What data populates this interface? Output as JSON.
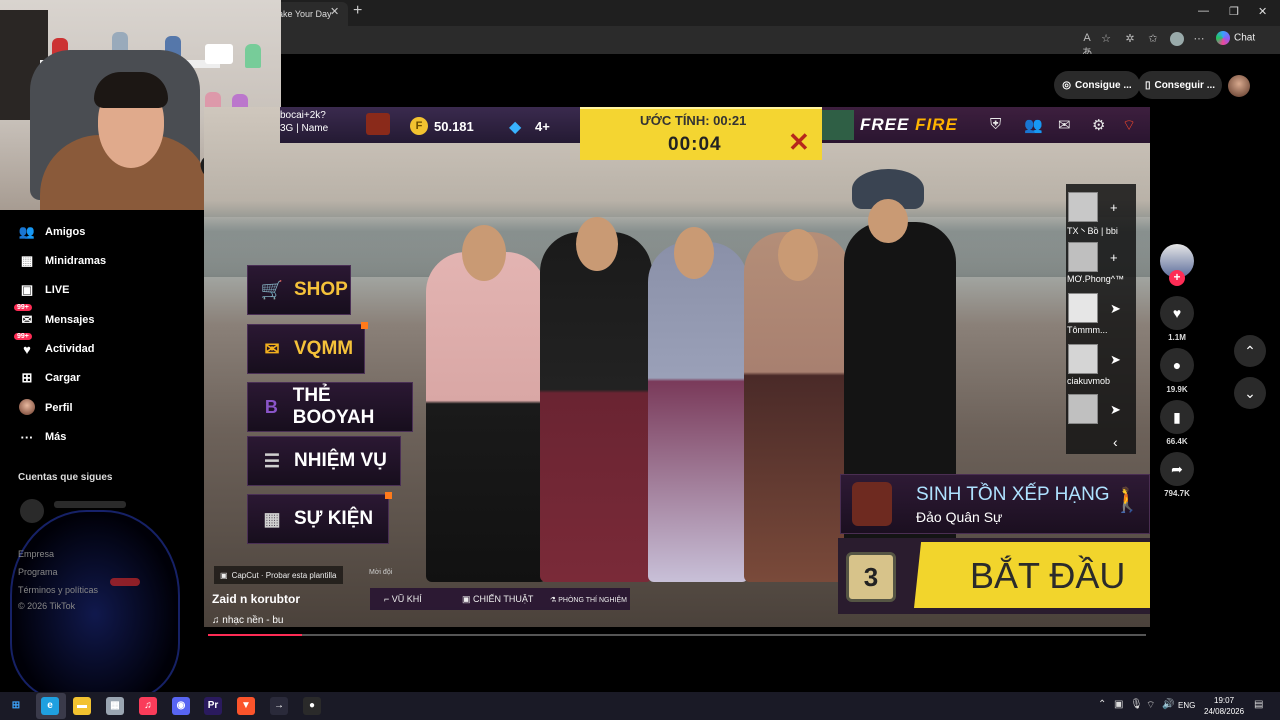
{
  "browser": {
    "tab_title": "ake Your Day",
    "tab_close": "✕",
    "new_tab": "+",
    "chat_label": "Chat"
  },
  "sidebar": {
    "items": [
      {
        "label": "Amigos",
        "icon": "friends-icon",
        "glyph": "👥"
      },
      {
        "label": "Minidramas",
        "icon": "film-icon",
        "glyph": "▦"
      },
      {
        "label": "LIVE",
        "icon": "live-icon",
        "glyph": "▣"
      },
      {
        "label": "Mensajes",
        "icon": "messages-icon",
        "glyph": "✉",
        "badge": "99+"
      },
      {
        "label": "Actividad",
        "icon": "activity-icon",
        "glyph": "♥",
        "badge": "99+"
      },
      {
        "label": "Cargar",
        "icon": "upload-icon",
        "glyph": "⊞"
      },
      {
        "label": "Perfil",
        "icon": "profile-avatar"
      },
      {
        "label": "Más",
        "icon": "more-icon",
        "glyph": "···"
      }
    ],
    "following_title": "Cuentas que sigues",
    "footer": [
      "Empresa",
      "Programa",
      "Términos y políticas",
      "© 2026 TikTok"
    ]
  },
  "header": {
    "consigue_label": "Consigue ...",
    "conseguir_label": "Conseguir ..."
  },
  "game": {
    "player_name_line1": "bocai+2k?",
    "player_name_line2": "3G | Name",
    "coins": "50.181",
    "diamonds": "4+",
    "timer_label": "ƯỚC TÍNH: 00:21",
    "timer_value": "00:04",
    "logo_part1": "FREE ",
    "logo_part2": "FIRE",
    "menu": [
      {
        "label": "SHOP",
        "icon": "shop-cart-icon",
        "color": "#f2b01e"
      },
      {
        "label": "VQMM",
        "icon": "prize-wheel-icon",
        "color": "#f2b01e"
      },
      {
        "label": "THẺ BOOYAH",
        "icon": "booyah-pass-icon",
        "color": "#8a55c8"
      },
      {
        "label": "NHIỆM VỤ",
        "icon": "mission-list-icon",
        "color": "#cfcfcf"
      },
      {
        "label": "SỰ KIỆN",
        "icon": "event-calendar-icon",
        "color": "#cfcfcf"
      }
    ],
    "friends": [
      {
        "name": "TX丶Bồ | bbi"
      },
      {
        "name": "MƠ.Phong^™"
      },
      {
        "name": "Tômmm..."
      },
      {
        "name": "ciakuvmob"
      },
      {
        "name": ""
      }
    ],
    "mode_title": "SINH TỒN XẾP HẠNG",
    "mode_subtitle": "Đảo Quân Sự",
    "start_label": "BẮT ĐẦU",
    "dice_number": "3",
    "tools": [
      "VŨ KHÍ",
      "CHIẾN THUẬT",
      "PHÒNG THÍ NGHIỆM"
    ],
    "ticker": "Mời đội"
  },
  "video": {
    "capcut_label": "CapCut · Probar esta plantilla",
    "author": "Zaid  n korubtor",
    "music": "nhạc nền  - bu",
    "progress_fraction": 0.1
  },
  "actions": {
    "likes": "1.1M",
    "comments": "19.9K",
    "saves": "66.4K",
    "shares": "794.7K"
  },
  "taskbar": {
    "apps": [
      {
        "name": "start-menu-icon",
        "glyph": "⊞",
        "color": "#3ea6ff"
      },
      {
        "name": "browser-edge-icon",
        "glyph": "e",
        "color": "#1fa0e0"
      },
      {
        "name": "file-explorer-icon",
        "glyph": "▬",
        "color": "#f2c230"
      },
      {
        "name": "calculator-icon",
        "glyph": "▦",
        "color": "#9aa5b1"
      },
      {
        "name": "music-app-icon",
        "glyph": "♫",
        "color": "#fa3c5a"
      },
      {
        "name": "discord-icon",
        "glyph": "◉",
        "color": "#5865f2"
      },
      {
        "name": "premiere-icon",
        "glyph": "Pr",
        "color": "#2a1a5e"
      },
      {
        "name": "brave-icon",
        "glyph": "▼",
        "color": "#fb542b"
      },
      {
        "name": "arrow-app-icon",
        "glyph": "→",
        "color": "#2a2a3a"
      },
      {
        "name": "obs-icon",
        "glyph": "●",
        "color": "#2a2a2a"
      }
    ],
    "language": "ENG",
    "time": "19:07",
    "date": "24/08/2026"
  }
}
